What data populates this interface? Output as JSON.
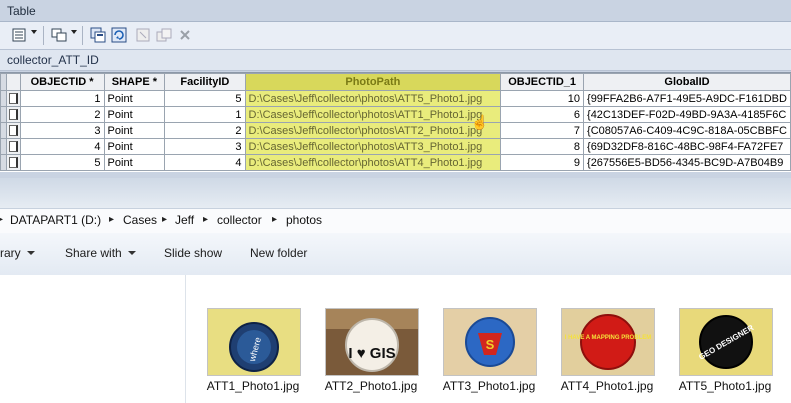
{
  "table_window": {
    "title": "Table",
    "toolbar": {
      "icons": [
        "table-options-icon",
        "related-tables-icon",
        "select-by-attributes-icon",
        "switch-selection-icon",
        "clear-selection-icon",
        "zoom-selected-icon",
        "delete-selected-icon"
      ]
    },
    "table_name": "collector_ATT_ID",
    "columns": [
      "OBJECTID *",
      "SHAPE *",
      "FacilityID",
      "PhotoPath",
      "OBJECTID_1",
      "GlobalID"
    ],
    "selected_column": "PhotoPath",
    "rows": [
      {
        "objectid": "1",
        "shape": "Point",
        "facilityid": "5",
        "photopath": "D:\\Cases\\Jeff\\collector\\photos\\ATT5_Photo1.jpg",
        "objectid_1": "10",
        "globalid": "{99FFA2B6-A7F1-49E5-A9DC-F161DBD"
      },
      {
        "objectid": "2",
        "shape": "Point",
        "facilityid": "1",
        "photopath": "D:\\Cases\\Jeff\\collector\\photos\\ATT1_Photo1.jpg",
        "objectid_1": "6",
        "globalid": "{42C13DEF-F02D-49BD-9A3A-4185F6C"
      },
      {
        "objectid": "3",
        "shape": "Point",
        "facilityid": "2",
        "photopath": "D:\\Cases\\Jeff\\collector\\photos\\ATT2_Photo1.jpg",
        "objectid_1": "7",
        "globalid": "{C08057A6-C409-4C9C-818A-05CBBFC"
      },
      {
        "objectid": "4",
        "shape": "Point",
        "facilityid": "3",
        "photopath": "D:\\Cases\\Jeff\\collector\\photos\\ATT3_Photo1.jpg",
        "objectid_1": "8",
        "globalid": "{69D32DF8-816C-48BC-98F4-FA72FE7"
      },
      {
        "objectid": "5",
        "shape": "Point",
        "facilityid": "4",
        "photopath": "D:\\Cases\\Jeff\\collector\\photos\\ATT4_Photo1.jpg",
        "objectid_1": "9",
        "globalid": "{267556E5-BD56-4345-BC9D-A7B04B9"
      }
    ]
  },
  "explorer": {
    "breadcrumb": [
      "DATAPART1 (D:)",
      "Cases",
      "Jeff",
      "collector",
      "photos"
    ],
    "toolbar": {
      "library_label": "rary",
      "share_with_label": "Share with",
      "slide_show_label": "Slide show",
      "new_folder_label": "New folder"
    },
    "files": [
      {
        "name": "ATT1_Photo1.jpg",
        "badge_text": "where"
      },
      {
        "name": "ATT2_Photo1.jpg",
        "badge_text": "I ♥ GIS"
      },
      {
        "name": "ATT3_Photo1.jpg",
        "badge_text": "S"
      },
      {
        "name": "ATT4_Photo1.jpg",
        "badge_text": "I HAVE A MAPPING PROBLEM"
      },
      {
        "name": "ATT5_Photo1.jpg",
        "badge_text": "GEO DESIGNER"
      }
    ]
  },
  "colors": {
    "selected_column_header": "#d8d85b",
    "selected_column_cells": "#e9ec7c",
    "window_chrome": "#c9d3e2"
  }
}
